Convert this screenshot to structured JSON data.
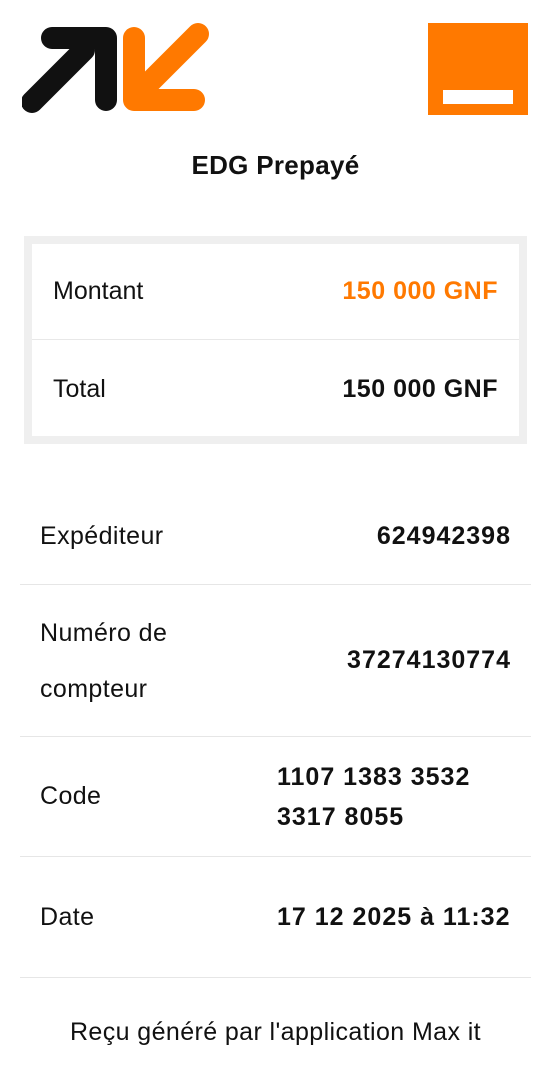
{
  "brand": {
    "arrows_logo_icon": "max-it-arrows-logo-icon",
    "square_logo_icon": "orange-square-logo-icon",
    "colors": {
      "accent": "#ff7900",
      "dark": "#111111"
    }
  },
  "service": {
    "title": "EDG Prepayé"
  },
  "amounts": {
    "montant_label": "Montant",
    "montant_value": "150 000 GNF",
    "total_label": "Total",
    "total_value": "150 000 GNF"
  },
  "details": {
    "sender_label": "Expéditeur",
    "sender_value": "624942398",
    "meter_label": "Numéro de compteur",
    "meter_value": "37274130774",
    "code_label": "Code",
    "code_value": "1107 1383 3532 3317 8055",
    "date_label": "Date",
    "date_value": "17 12 2025 à 11:32"
  },
  "footer": {
    "note": "Reçu généré par l'application Max it"
  }
}
